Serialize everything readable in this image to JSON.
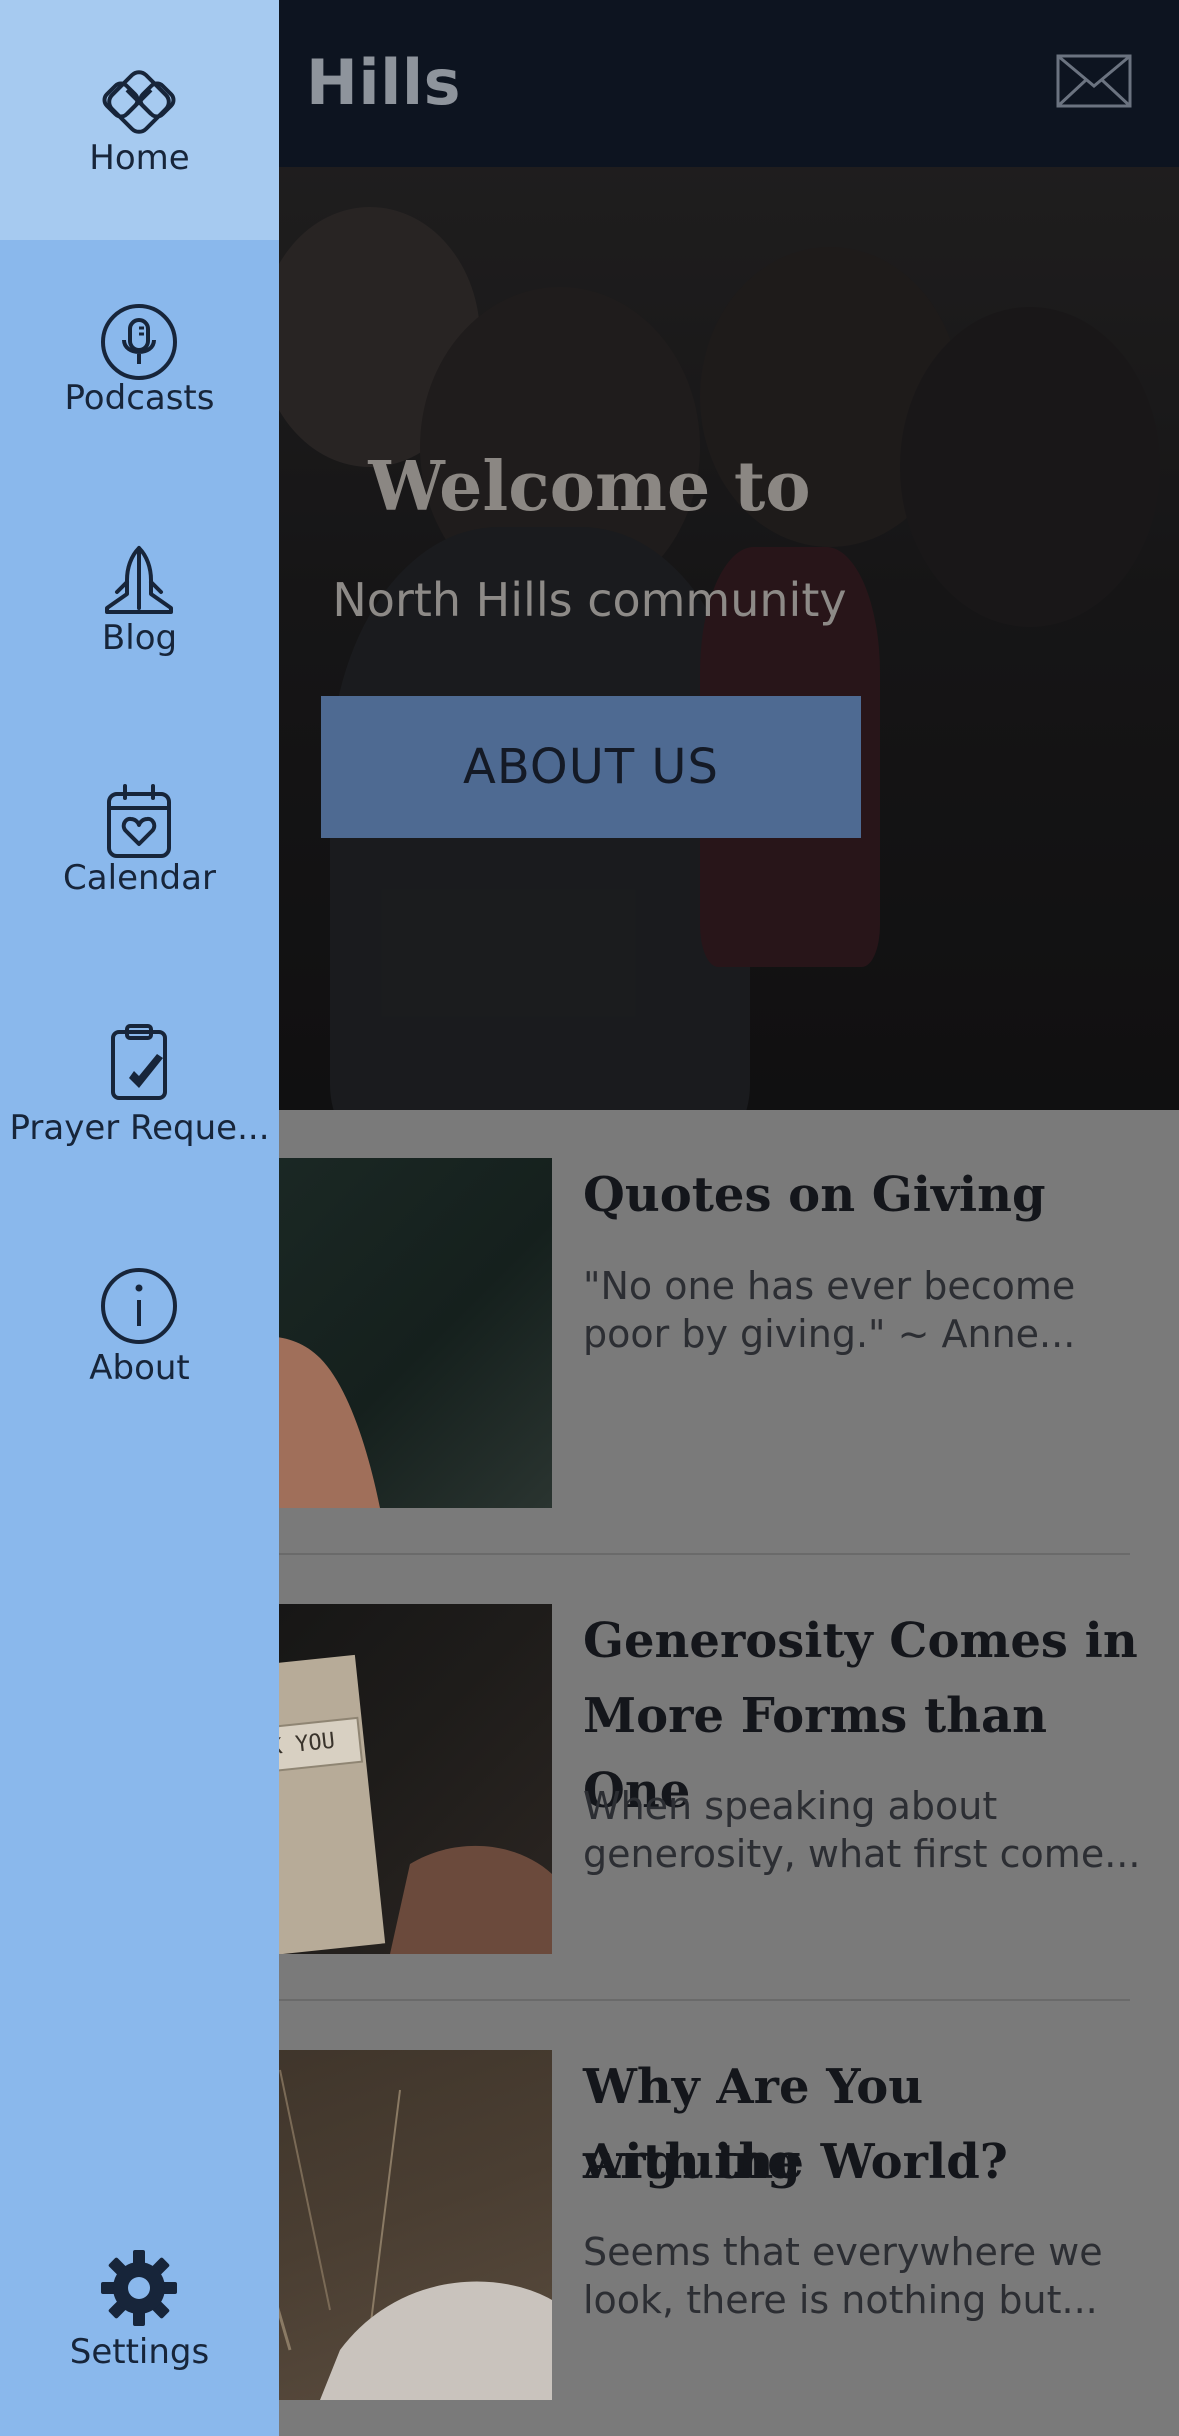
{
  "header": {
    "title": "rth Hills",
    "mail_icon": "mail-icon"
  },
  "hero": {
    "title": "Welcome to",
    "subtitle": "North Hills community",
    "button_label": "ABOUT US"
  },
  "posts": [
    {
      "title": "Quotes on Giving",
      "excerpt_line1": "\"No one has ever become",
      "excerpt_line2": "poor by giving.\" ~ Anne..."
    },
    {
      "title_line1": "Generosity Comes in",
      "title_line2": "More Forms than One",
      "excerpt_line1": "When speaking about",
      "excerpt_line2": "generosity, what first come...",
      "thumb_text": "K YOU"
    },
    {
      "title_line1": "Why Are You Arguing",
      "title_line2": "with the World?",
      "excerpt_line1": "Seems that everywhere we",
      "excerpt_line2": "look, there is nothing but..."
    }
  ],
  "drawer": {
    "items": [
      {
        "label": "Home",
        "icon": "home-knot-icon",
        "active": true
      },
      {
        "label": "Podcasts",
        "icon": "microphone-icon"
      },
      {
        "label": "Blog",
        "icon": "praying-hands-icon"
      },
      {
        "label": "Calendar",
        "icon": "calendar-heart-icon"
      },
      {
        "label": "Prayer Reque...",
        "icon": "clipboard-check-icon"
      },
      {
        "label": "About",
        "icon": "info-icon"
      }
    ],
    "settings": {
      "label": "Settings",
      "icon": "gear-icon"
    }
  },
  "colors": {
    "drawer_bg": "#8ab8ec",
    "drawer_active_bg": "#a6caf0",
    "header_bg": "#0d1420",
    "button_bg": "#4e6a92"
  }
}
